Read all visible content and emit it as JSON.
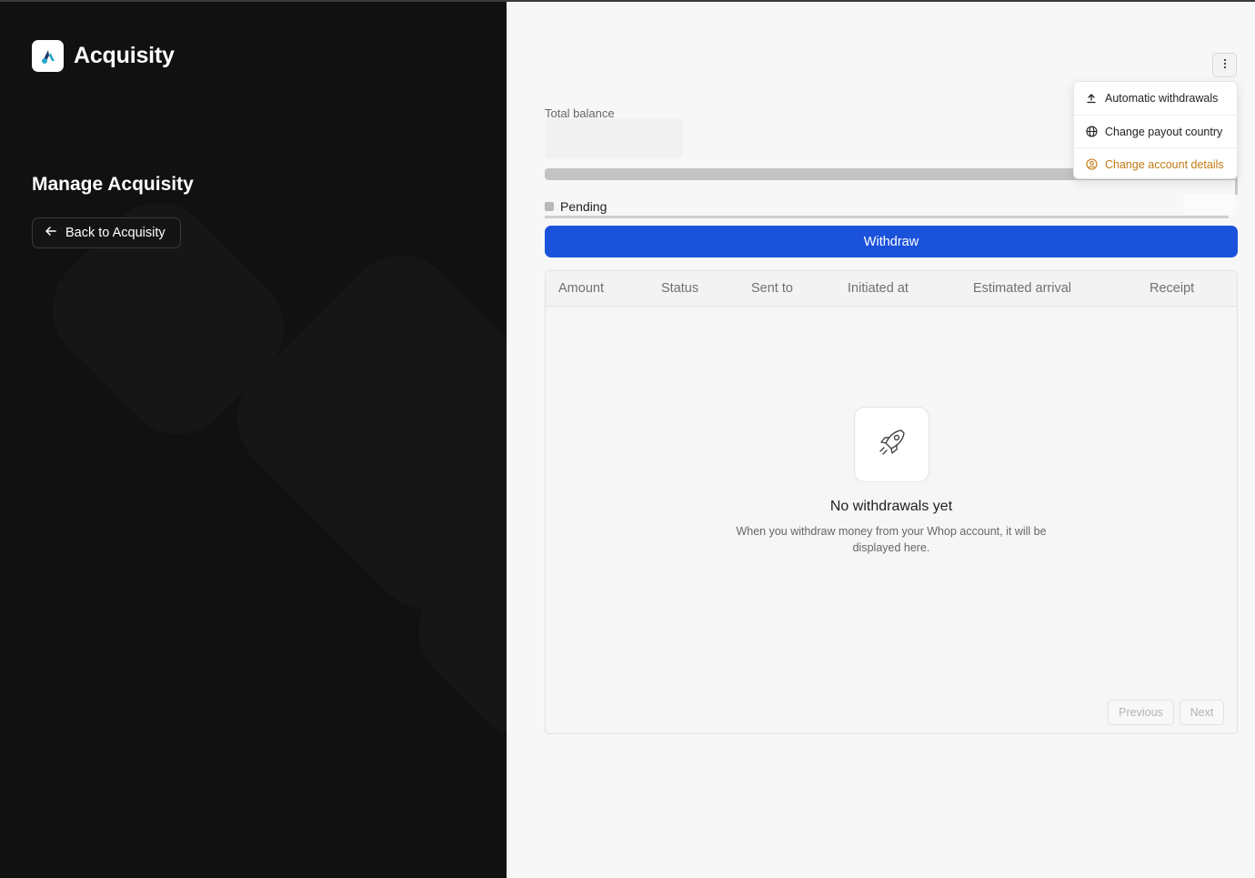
{
  "brand": {
    "name": "Acquisity"
  },
  "sidebar": {
    "title": "Manage Acquisity",
    "back_label": "Back to Acquisity"
  },
  "balance": {
    "label": "Total balance",
    "pending_label": "Pending"
  },
  "actions": {
    "withdraw_label": "Withdraw"
  },
  "menu": {
    "items": [
      {
        "label": "Automatic withdrawals",
        "icon": "upload-icon"
      },
      {
        "label": "Change payout country",
        "icon": "globe-icon"
      },
      {
        "label": "Change account details",
        "icon": "user-circle-icon",
        "color": "#c47a14"
      }
    ]
  },
  "table": {
    "columns": [
      "Amount",
      "Status",
      "Sent to",
      "Initiated at",
      "Estimated arrival",
      "Receipt"
    ],
    "empty_title": "No withdrawals yet",
    "empty_description": "When you withdraw money from your Whop account, it will be displayed here.",
    "empty_icon": "rocket-icon",
    "prev_label": "Previous",
    "next_label": "Next"
  },
  "colors": {
    "accent": "#1b52dc",
    "sidebar_bg": "#111111",
    "warning": "#c47a14"
  }
}
